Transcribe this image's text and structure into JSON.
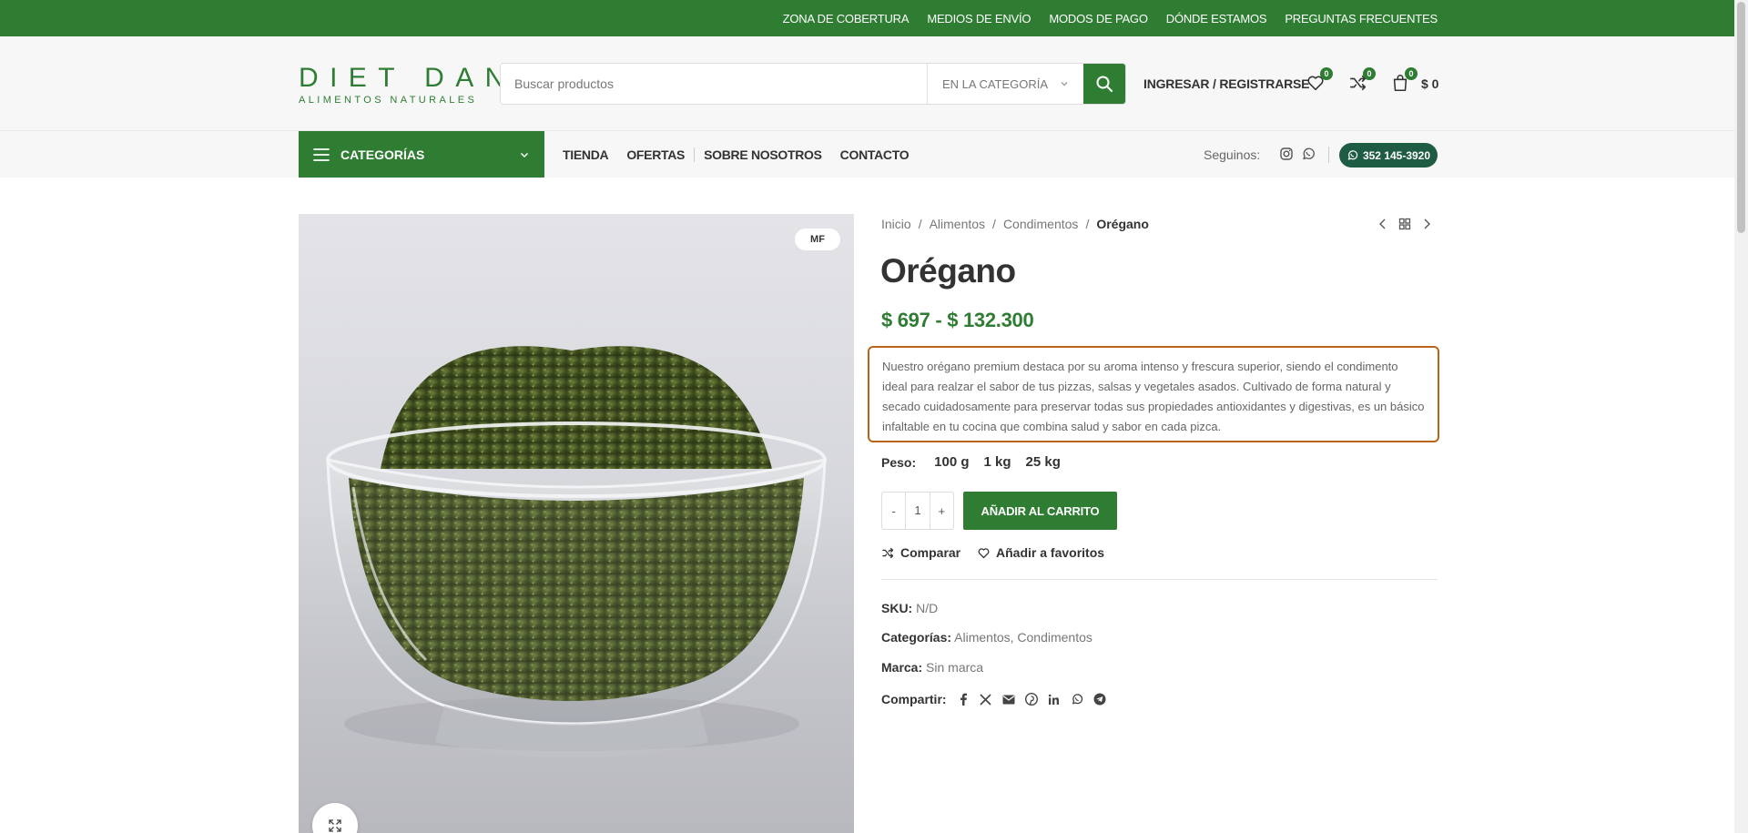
{
  "topbar": {
    "links": [
      "ZONA DE COBERTURA",
      "MEDIOS DE ENVÍO",
      "MODOS DE PAGO",
      "DÓNDE ESTAMOS",
      "PREGUNTAS FRECUENTES"
    ]
  },
  "header": {
    "logo_main": "DIET DANI",
    "logo_sub": "ALIMENTOS NATURALES",
    "search_placeholder": "Buscar productos",
    "search_category": "EN LA CATEGORÍA",
    "login": "INGRESAR / REGISTRARSE",
    "wishlist_count": "0",
    "compare_count": "0",
    "cart_count": "0",
    "cart_total": "$ 0"
  },
  "nav": {
    "categories": "CATEGORÍAS",
    "links": [
      "TIENDA",
      "OFERTAS",
      "SOBRE NOSOTROS",
      "CONTACTO"
    ],
    "follow": "Seguinos:",
    "phone": "352 145-3920"
  },
  "product": {
    "badge": "MF",
    "breadcrumb": [
      "Inicio",
      "Alimentos",
      "Condimentos",
      "Orégano"
    ],
    "title": "Orégano",
    "price": "$ 697 - $ 132.300",
    "description": "Nuestro orégano premium destaca por su aroma intenso y frescura superior, siendo el condimento ideal para realzar el sabor de tus pizzas, salsas y vegetales asados. Cultivado de forma natural y secado cuidadosamente para preservar todas sus propiedades antioxidantes y digestivas, es un básico infaltable en tu cocina que combina salud y sabor en cada pizca.",
    "weight_label": "Peso",
    "weight_options": [
      "100 g",
      "1 kg",
      "25 kg"
    ],
    "qty_minus": "-",
    "qty": "1",
    "qty_plus": "+",
    "add_to_cart": "AÑADIR AL CARRITO",
    "compare": "Comparar",
    "favorites": "Añadir a favoritos",
    "sku_label": "SKU:",
    "sku": "N/D",
    "categories_label": "Categorías:",
    "categories": "Alimentos, Condimentos",
    "brand_label": "Marca:",
    "brand": "Sin marca",
    "share_label": "Compartir:"
  },
  "colors": {
    "brand_green": "#2e7d32",
    "phone_green": "#1f5c44",
    "highlight_border": "#b8651a"
  }
}
